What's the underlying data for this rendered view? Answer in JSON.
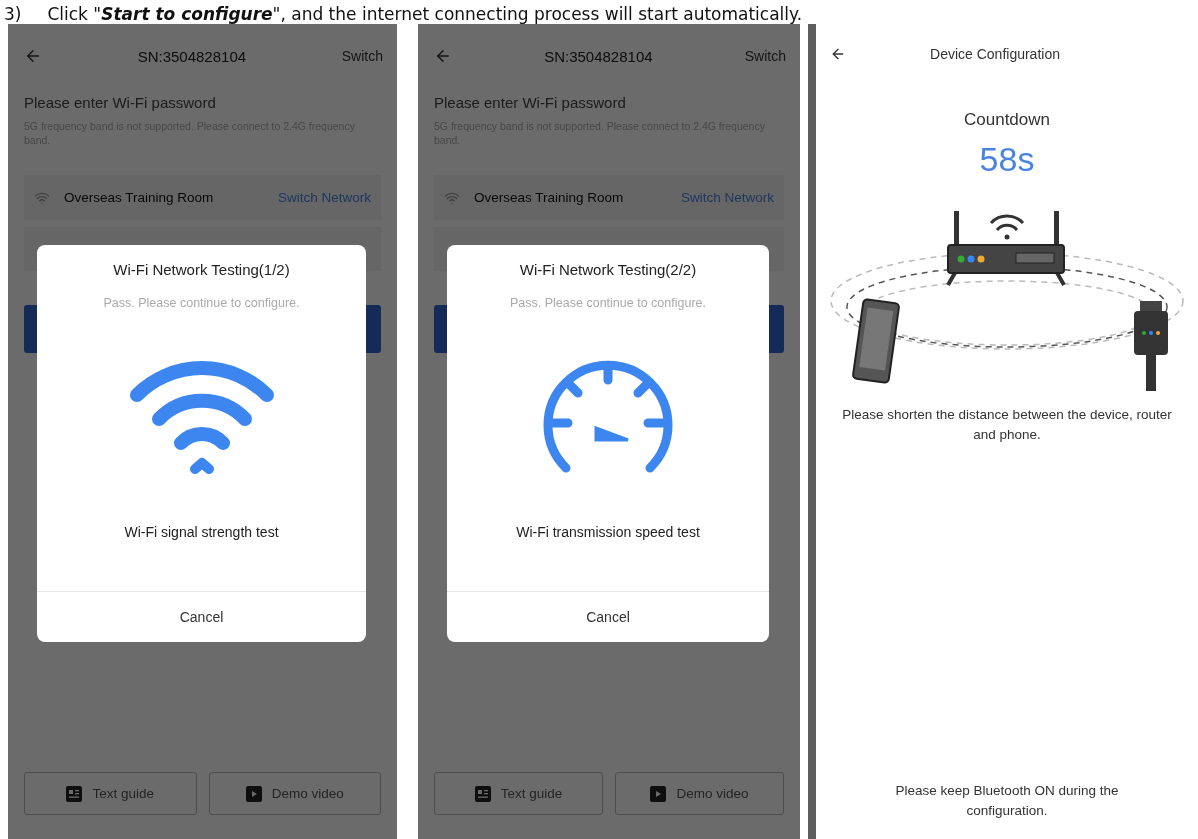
{
  "instruction": {
    "number": "3)",
    "text": "Click \"**Start to configure**\", and the internet connecting process will start automatically."
  },
  "screens": [
    {
      "kind": "testing",
      "header": {
        "title": "SN:3504828104",
        "action": "Switch"
      },
      "prompt": "Please enter Wi-Fi password",
      "hint": "5G frequency band is not supported. Please connect to 2.4G frequency band.",
      "network": {
        "name": "Overseas Training Room",
        "action": "Switch Network"
      },
      "dialog": {
        "title": "Wi-Fi Network Testing(1/2)",
        "status": "Pass. Please continue to configure.",
        "kind": "signal",
        "test": "Wi-Fi signal strength test",
        "button": "Cancel"
      },
      "footer_buttons": [
        {
          "label": "Text guide",
          "kind": "guide"
        },
        {
          "label": "Demo video",
          "kind": "video"
        }
      ]
    },
    {
      "kind": "testing",
      "header": {
        "title": "SN:3504828104",
        "action": "Switch"
      },
      "prompt": "Please enter Wi-Fi password",
      "hint": "5G frequency band is not supported. Please connect to 2.4G frequency band.",
      "network": {
        "name": "Overseas Training Room",
        "action": "Switch Network"
      },
      "dialog": {
        "title": "Wi-Fi Network Testing(2/2)",
        "status": "Pass. Please continue to configure.",
        "kind": "speed",
        "test": "Wi-Fi transmission speed test",
        "button": "Cancel"
      },
      "footer_buttons": [
        {
          "label": "Text guide",
          "kind": "guide"
        },
        {
          "label": "Demo video",
          "kind": "video"
        }
      ]
    },
    {
      "kind": "countdown",
      "header": {
        "title": "Device Configuration"
      },
      "label": "Countdown",
      "time": "58s",
      "tip": "Please shorten the distance between the device, router and phone.",
      "note": "Please keep Bluetooth ON during the configuration."
    }
  ]
}
